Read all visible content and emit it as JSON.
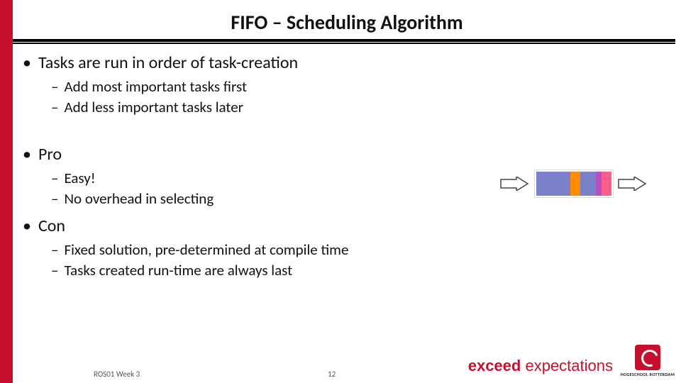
{
  "title": "FIFO – Scheduling Algorithm",
  "bullets": {
    "tasks": {
      "label": "Tasks are run in order of task-creation",
      "sub1": "Add most important tasks first",
      "sub2": "Add less important tasks later"
    },
    "pro": {
      "label": "Pro",
      "sub1": "Easy!",
      "sub2": "No overhead in selecting"
    },
    "con": {
      "label": "Con",
      "sub1": "Fixed solution, pre-determined at compile time",
      "sub2": "Tasks created run-time are always last"
    }
  },
  "footer": {
    "course": "ROS01 Week 3",
    "page": "12"
  },
  "branding": {
    "exceed": "exceed",
    "expectations": "expectations",
    "school": "HOGESCHOOL ROTTERDAM"
  }
}
